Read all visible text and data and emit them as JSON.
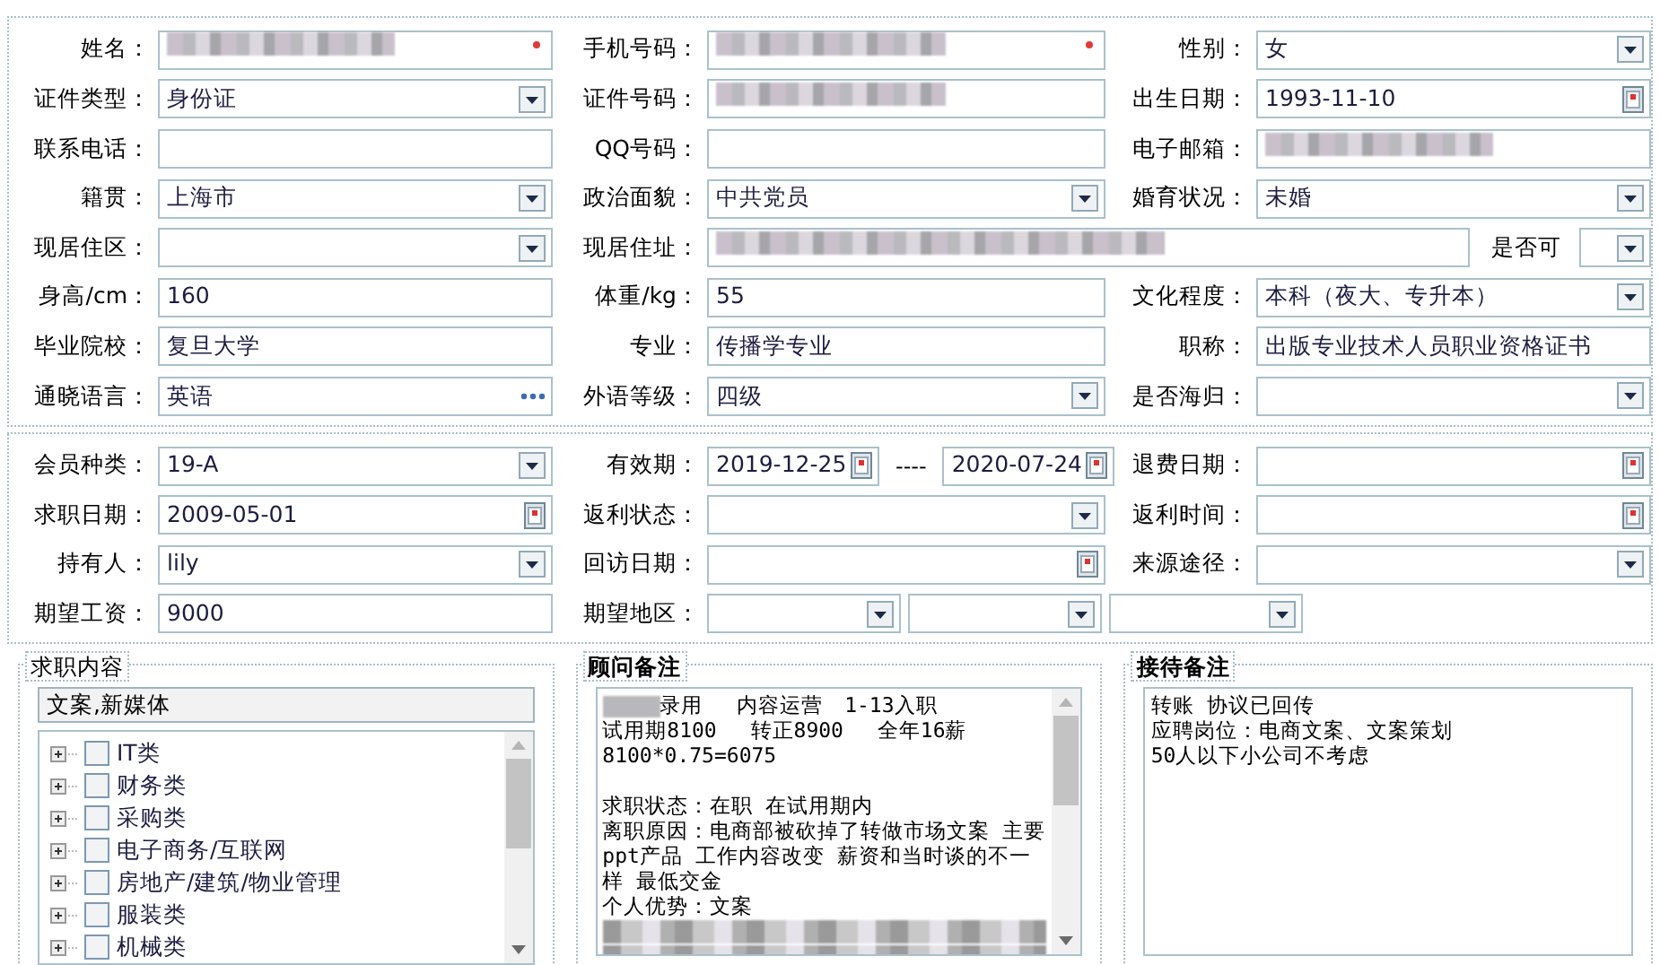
{
  "sections": [
    {
      "rows": [
        [
          {
            "label": "姓名：",
            "kind": "single",
            "controls": [
              {
                "kind": "text",
                "redacted": true,
                "required": true
              }
            ]
          },
          {
            "label": "手机号码：",
            "kind": "single",
            "controls": [
              {
                "kind": "text",
                "redacted": true,
                "required": true
              }
            ]
          },
          {
            "label": "性别：",
            "kind": "single",
            "controls": [
              {
                "kind": "select",
                "value": "女"
              }
            ]
          }
        ],
        [
          {
            "label": "证件类型：",
            "kind": "single",
            "controls": [
              {
                "kind": "select",
                "value": "身份证"
              }
            ]
          },
          {
            "label": "证件号码：",
            "kind": "single",
            "controls": [
              {
                "kind": "text",
                "redacted": true
              }
            ]
          },
          {
            "label": "出生日期：",
            "kind": "single",
            "controls": [
              {
                "kind": "date",
                "value": "1993-11-10"
              }
            ]
          }
        ],
        [
          {
            "label": "联系电话：",
            "kind": "single",
            "controls": [
              {
                "kind": "text"
              }
            ]
          },
          {
            "label": "QQ号码：",
            "kind": "single",
            "controls": [
              {
                "kind": "text"
              }
            ]
          },
          {
            "label": "电子邮箱：",
            "kind": "single",
            "controls": [
              {
                "kind": "text",
                "redacted": true
              }
            ]
          }
        ],
        [
          {
            "label": "籍贯：",
            "kind": "single",
            "controls": [
              {
                "kind": "select",
                "value": "上海市"
              }
            ]
          },
          {
            "label": "政治面貌：",
            "kind": "single",
            "controls": [
              {
                "kind": "select",
                "value": "中共党员"
              }
            ]
          },
          {
            "label": "婚育状况：",
            "kind": "single",
            "controls": [
              {
                "kind": "select",
                "value": "未婚"
              }
            ]
          }
        ],
        [
          {
            "label": "现居住区：",
            "kind": "single",
            "controls": [
              {
                "kind": "select"
              }
            ]
          },
          {
            "label": "现居住址：",
            "kind": "with-option",
            "controls": [
              {
                "kind": "text",
                "redacted": true
              },
              {
                "kind": "label",
                "text": "是否可"
              },
              {
                "kind": "select"
              }
            ]
          }
        ],
        [
          {
            "label": "身高/cm：",
            "kind": "single",
            "controls": [
              {
                "kind": "text",
                "value": "160"
              }
            ]
          },
          {
            "label": "体重/kg：",
            "kind": "single",
            "controls": [
              {
                "kind": "text",
                "value": "55"
              }
            ]
          },
          {
            "label": "文化程度：",
            "kind": "single",
            "controls": [
              {
                "kind": "select",
                "value": "本科（夜大、专升本）"
              }
            ]
          }
        ],
        [
          {
            "label": "毕业院校：",
            "kind": "single",
            "controls": [
              {
                "kind": "text",
                "value": "复旦大学"
              }
            ]
          },
          {
            "label": "专业：",
            "kind": "single",
            "controls": [
              {
                "kind": "text",
                "value": "传播学专业"
              }
            ]
          },
          {
            "label": "职称：",
            "kind": "single",
            "controls": [
              {
                "kind": "text",
                "value": "出版专业技术人员职业资格证书"
              }
            ]
          }
        ],
        [
          {
            "label": "通晓语言：",
            "kind": "single",
            "controls": [
              {
                "kind": "lookup",
                "value": "英语"
              }
            ]
          },
          {
            "label": "外语等级：",
            "kind": "single",
            "controls": [
              {
                "kind": "select",
                "value": "四级"
              }
            ]
          },
          {
            "label": "是否海归：",
            "kind": "single",
            "controls": [
              {
                "kind": "select"
              }
            ]
          }
        ]
      ]
    },
    {
      "rows": [
        [
          {
            "label": "会员种类：",
            "kind": "single",
            "controls": [
              {
                "kind": "select",
                "value": "19-A"
              }
            ]
          },
          {
            "label": "有效期：",
            "kind": "range",
            "controls": [
              {
                "kind": "date",
                "value": "2019-12-25"
              },
              {
                "kind": "separator",
                "text": "----"
              },
              {
                "kind": "date",
                "value": "2020-07-24"
              }
            ]
          },
          {
            "label": "退费日期：",
            "kind": "single",
            "controls": [
              {
                "kind": "date"
              }
            ]
          }
        ],
        [
          {
            "label": "求职日期：",
            "kind": "single",
            "controls": [
              {
                "kind": "date",
                "value": "2009-05-01"
              }
            ]
          },
          {
            "label": "返利状态：",
            "kind": "single",
            "controls": [
              {
                "kind": "select"
              }
            ]
          },
          {
            "label": "返利时间：",
            "kind": "single",
            "controls": [
              {
                "kind": "date"
              }
            ]
          }
        ],
        [
          {
            "label": "持有人：",
            "kind": "single",
            "controls": [
              {
                "kind": "select",
                "value": "lily"
              }
            ]
          },
          {
            "label": "回访日期：",
            "kind": "single",
            "controls": [
              {
                "kind": "date"
              }
            ]
          },
          {
            "label": "来源途径：",
            "kind": "single",
            "controls": [
              {
                "kind": "select"
              }
            ]
          }
        ],
        [
          {
            "label": "期望工资：",
            "kind": "single",
            "controls": [
              {
                "kind": "text",
                "value": "9000"
              }
            ]
          },
          {
            "label": "期望地区：",
            "kind": "triple",
            "controls": [
              {
                "kind": "select"
              },
              {
                "kind": "select"
              },
              {
                "kind": "select"
              }
            ]
          }
        ]
      ]
    }
  ],
  "job_content": {
    "title": "求职内容",
    "selected_text": "文案,新媒体",
    "tree": [
      {
        "label": "IT类",
        "expanded": false,
        "checked": false
      },
      {
        "label": "财务类",
        "expanded": false,
        "checked": false
      },
      {
        "label": "采购类",
        "expanded": false,
        "checked": false
      },
      {
        "label": "电子商务/互联网",
        "expanded": false,
        "checked": false
      },
      {
        "label": "房地产/建筑/物业管理",
        "expanded": false,
        "checked": false
      },
      {
        "label": "服装类",
        "expanded": false,
        "checked": false
      },
      {
        "label": "机械类",
        "expanded": false,
        "checked": false
      }
    ]
  },
  "consultant_notes": {
    "title": "顾问备注",
    "lines": [
      {
        "kind": "text",
        "text": "录用　 内容运营　1-13入职",
        "redacted_prefix": true
      },
      {
        "kind": "text",
        "text": "试用期8100　 转正8900　 全年16薪"
      },
      {
        "kind": "text",
        "text": "8100*0.75=6075"
      },
      {
        "kind": "blank"
      },
      {
        "kind": "text",
        "text": "求职状态：在职 在试用期内"
      },
      {
        "kind": "text",
        "text": "离职原因：电商部被砍掉了转做市场文案 主要ppt产品 工作内容改变 薪资和当时谈的不一样 最低交金"
      },
      {
        "kind": "text",
        "text": "个人优势：文案"
      },
      {
        "kind": "redacted"
      },
      {
        "kind": "redacted"
      }
    ]
  },
  "reception_notes": {
    "title": "接待备注",
    "lines": [
      {
        "kind": "text",
        "text": "转账 协议已回传"
      },
      {
        "kind": "text",
        "text": "应聘岗位：电商文案、文案策划"
      },
      {
        "kind": "text",
        "text": "50人以下小公司不考虑"
      }
    ]
  }
}
